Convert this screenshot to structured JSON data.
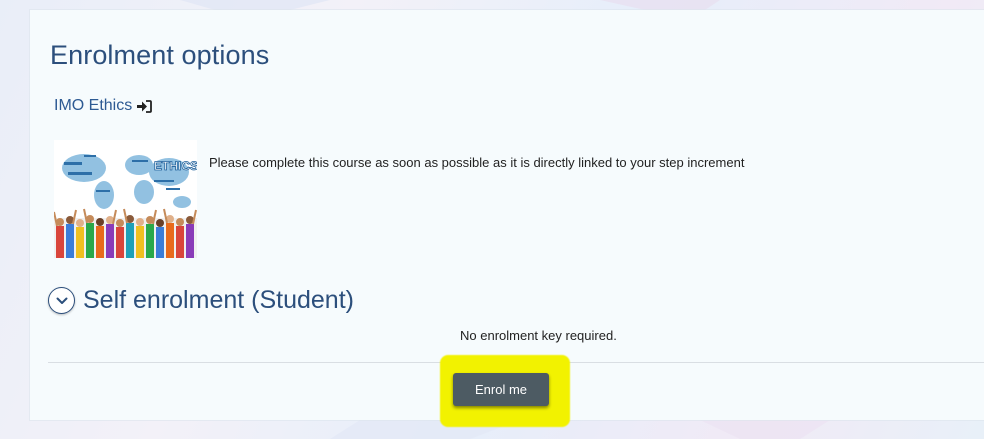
{
  "page": {
    "title": "Enrolment options"
  },
  "course": {
    "name": "IMO Ethics",
    "link_icon": "sign-in-icon",
    "image_icon": "course-image",
    "summary": "Please complete this course as soon as possible as it is directly linked to your step increment"
  },
  "enrolment": {
    "section_title": "Self enrolment (Student)",
    "toggle_icon": "chevron-down-icon",
    "key_note": "No enrolment key required.",
    "button_label": "Enrol me"
  },
  "colors": {
    "heading": "#2c4f7c",
    "link": "#2d5a93",
    "button_bg": "#4d5b63",
    "highlight": "#f2f200",
    "card_bg": "#f6fbfd"
  }
}
